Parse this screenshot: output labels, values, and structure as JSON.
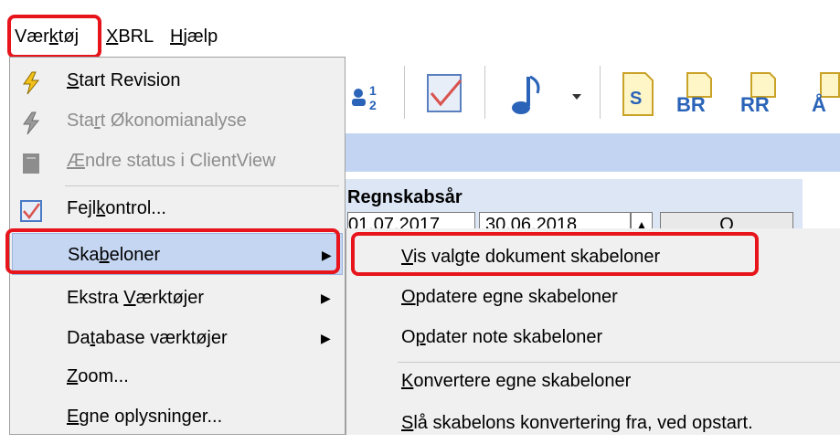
{
  "menubar": {
    "items": [
      {
        "pre": "Vær",
        "key": "k",
        "post": "tøj"
      },
      {
        "pre": "",
        "key": "X",
        "post": "BRL"
      },
      {
        "pre": "",
        "key": "H",
        "post": "jælp"
      }
    ]
  },
  "toolbar": {
    "icons": [
      "sort-users-icon",
      "checkmark-document-icon",
      "music-note-icon",
      "dropdown-arrow-icon",
      "s-document-icon",
      "br-icon",
      "rr-icon",
      "partial-icon"
    ],
    "br_text": "BR",
    "rr_text": "RR",
    "s_text": "S",
    "partial_text": "Å"
  },
  "panel": {
    "label": "Regnskabsår",
    "start_date": "01.07.2017",
    "end_date": "30.06.2018",
    "button_text": "O"
  },
  "menu": {
    "items": [
      {
        "pre": "",
        "key": "S",
        "post": "tart Revision",
        "icon": "lightning-icon",
        "enabled": true
      },
      {
        "pre": "Sta",
        "key": "r",
        "post": "t Økonomianalyse",
        "icon": "lightning-icon",
        "enabled": false
      },
      {
        "pre": "",
        "key": "Æ",
        "post": "ndre status i ClientView",
        "icon": "status-icon",
        "enabled": false
      },
      {
        "pre": "Fejl",
        "key": "k",
        "post": "ontrol...",
        "icon": "checkmark-icon",
        "enabled": true
      },
      {
        "pre": "Ska",
        "key": "b",
        "post": "eloner",
        "enabled": true,
        "submenu": true
      },
      {
        "pre": "Ekstra ",
        "key": "V",
        "post": "ærktøjer",
        "enabled": true,
        "submenu": true
      },
      {
        "pre": "Da",
        "key": "t",
        "post": "abase værktøjer",
        "enabled": true,
        "submenu": true
      },
      {
        "pre": "",
        "key": "Z",
        "post": "oom...",
        "enabled": true
      },
      {
        "pre": "",
        "key": "E",
        "post": "gne oplysninger...",
        "enabled": true
      }
    ]
  },
  "submenu": {
    "items": [
      {
        "pre": "",
        "key": "V",
        "post": "is valgte dokument skabeloner"
      },
      {
        "pre": "",
        "key": "O",
        "post": "pdatere egne skabeloner"
      },
      {
        "pre": "O",
        "key": "p",
        "post": "dater note skabeloner"
      },
      {
        "pre": "",
        "key": "K",
        "post": "onvertere egne skabeloner"
      },
      {
        "pre": "",
        "key": "S",
        "post": "lå skabelons konvertering fra, ved opstart."
      }
    ]
  },
  "colors": {
    "highlight_red": "#e8141c",
    "selection_blue": "#c5d6f2",
    "menu_bg": "#f0f0f0",
    "bluebar": "#c3d4f3"
  }
}
